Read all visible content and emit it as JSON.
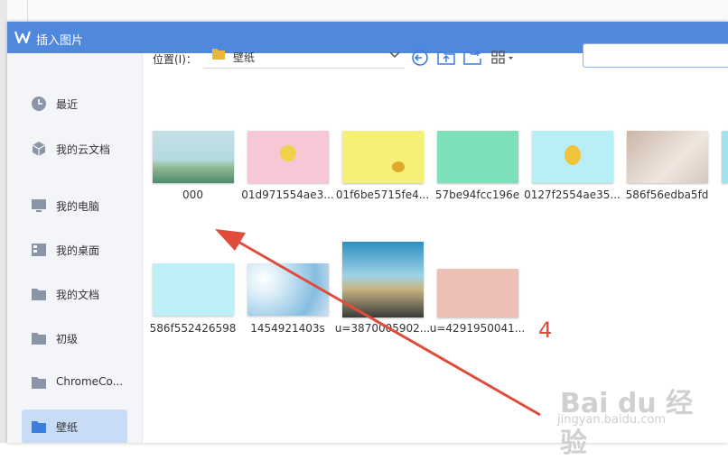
{
  "dialog": {
    "title": "插入图片"
  },
  "sidebar": {
    "items": [
      {
        "label": "最近",
        "icon": "clock-icon"
      },
      {
        "label": "我的云文档",
        "icon": "cloud-cube-icon"
      },
      {
        "label": "我的电脑",
        "icon": "monitor-icon"
      },
      {
        "label": "我的桌面",
        "icon": "desktop-icon"
      },
      {
        "label": "我的文档",
        "icon": "folder-icon"
      },
      {
        "label": "初级",
        "icon": "folder-icon"
      },
      {
        "label": "ChromeCo...",
        "icon": "folder-icon"
      },
      {
        "label": "壁纸",
        "icon": "folder-icon",
        "active": true
      }
    ]
  },
  "location": {
    "label": "位置(I)：",
    "value": "壁纸"
  },
  "toolbar": {
    "back": "back-icon",
    "up_folder": "up-folder-icon",
    "new_folder": "new-folder-icon",
    "view_mode": "grid-view-icon"
  },
  "files": [
    {
      "name": "000"
    },
    {
      "name": "01d971554ae3..."
    },
    {
      "name": "01f6be5715fe4..."
    },
    {
      "name": "57be94fcc196e"
    },
    {
      "name": "0127f2554ae35..."
    },
    {
      "name": "586f56edba5fd"
    },
    {
      "name": ""
    },
    {
      "name": "586f552426598"
    },
    {
      "name": "1454921403s"
    },
    {
      "name": "u=38700059​02..."
    },
    {
      "name": "u=4291950041..."
    }
  ],
  "annotation": {
    "number": "4"
  },
  "watermark": {
    "main": "Bai du 经验",
    "sub": "jingyan.baidu.com"
  },
  "colors": {
    "titlebar": "#4f88dc",
    "active_nav": "#c9dcf6",
    "arrow": "#e04b3a"
  }
}
